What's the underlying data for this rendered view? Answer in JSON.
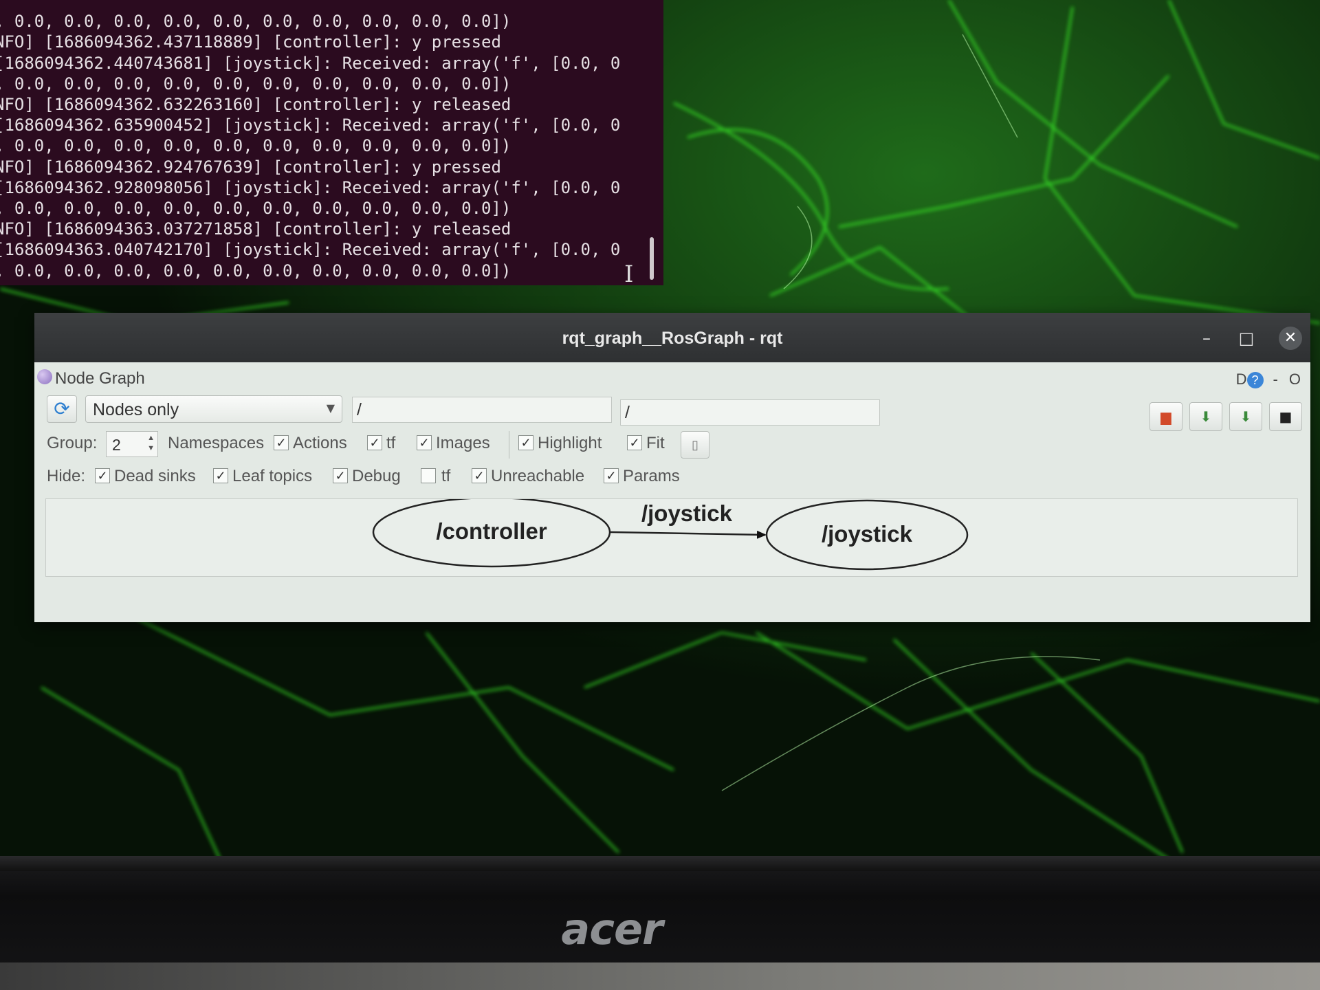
{
  "terminal": {
    "lines": [
      ", 0.0, 0.0, 0.0, 0.0, 0.0, 0.0, 0.0, 0.0, 0.0, 0.0])",
      "NFO] [1686094362.437118889] [controller]: y pressed",
      "[1686094362.440743681] [joystick]: Received: array('f', [0.0, 0",
      ", 0.0, 0.0, 0.0, 0.0, 0.0, 0.0, 0.0, 0.0, 0.0, 0.0])",
      "NFO] [1686094362.632263160] [controller]: y released",
      "[1686094362.635900452] [joystick]: Received: array('f', [0.0, 0",
      ", 0.0, 0.0, 0.0, 0.0, 0.0, 0.0, 0.0, 0.0, 0.0, 0.0])",
      "NFO] [1686094362.924767639] [controller]: y pressed",
      "[1686094362.928098056] [joystick]: Received: array('f', [0.0, 0",
      ", 0.0, 0.0, 0.0, 0.0, 0.0, 0.0, 0.0, 0.0, 0.0, 0.0])",
      "NFO] [1686094363.037271858] [controller]: y released",
      "[1686094363.040742170] [joystick]: Received: array('f', [0.0, 0",
      ", 0.0, 0.0, 0.0, 0.0, 0.0, 0.0, 0.0, 0.0, 0.0, 0.0])"
    ]
  },
  "window": {
    "title": "rqt_graph__RosGraph - rqt",
    "minimize": "–",
    "maximize": "□",
    "close": "✕"
  },
  "plugin": {
    "title": "Node Graph",
    "d_label": "D",
    "help": "?",
    "dash": "-",
    "o_label": "O"
  },
  "toolbar": {
    "mode": "Nodes only",
    "namespace_filter": "/",
    "topic_filter": "/"
  },
  "options": {
    "group_label": "Group:",
    "group_value": "2",
    "namespaces": "Namespaces",
    "namespaces_checked": true,
    "actions": "Actions",
    "actions_checked": true,
    "tf": "tf",
    "tf_checked": true,
    "images": "Images",
    "images_checked": true,
    "highlight": "Highlight",
    "highlight_checked": true,
    "fit": "Fit",
    "fit_checked": true
  },
  "hide": {
    "label": "Hide:",
    "dead_sinks": "Dead sinks",
    "dead_sinks_checked": true,
    "leaf_topics": "Leaf topics",
    "leaf_topics_checked": true,
    "debug": "Debug",
    "debug_checked": true,
    "tf": "tf",
    "tf_checked": false,
    "unreachable": "Unreachable",
    "unreachable_checked": true,
    "params": "Params",
    "params_checked": true
  },
  "graph": {
    "nodes": [
      "/controller",
      "/joystick"
    ],
    "edge_label": "/joystick"
  },
  "monitor": {
    "brand": "acer"
  },
  "colors": {
    "terminal_bg": "#2b0b1f",
    "wallpaper_glow": "#39ff2f",
    "titlebar": "#2e3032",
    "window_bg": "#e3e9e4"
  }
}
